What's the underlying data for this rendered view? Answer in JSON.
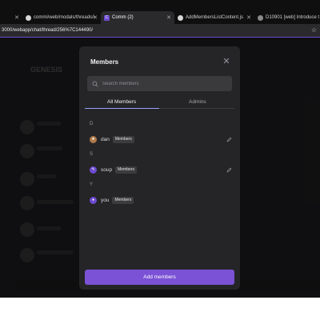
{
  "browser": {
    "tabs": [
      {
        "label": "commi/web/modals/threads/i",
        "icon": "github-icon"
      },
      {
        "label": "Comm (2)",
        "icon": "comm-icon",
        "active": true
      },
      {
        "label": "AddMembersListContent.js",
        "icon": "github-icon"
      },
      {
        "label": "D10901 [web] Introduce t",
        "icon": "phabricator-icon"
      }
    ],
    "url": "3000/webapp/chat/thread/256%7C144490/"
  },
  "background": {
    "community_name": "GENESIS"
  },
  "modal": {
    "title": "Members",
    "search_placeholder": "Search members",
    "tabs": [
      "All Members",
      "Admins"
    ],
    "groups": [
      {
        "letter": "D",
        "members": [
          {
            "name": "dan",
            "badge": "Members",
            "avatar_color": "#b07a4a",
            "avatar_glyph": "★",
            "editable": true
          }
        ]
      },
      {
        "letter": "S",
        "members": [
          {
            "name": "soup",
            "badge": "Members",
            "avatar_color": "#6d4bd0",
            "avatar_glyph": "✎",
            "editable": true
          }
        ]
      },
      {
        "letter": "Y",
        "members": [
          {
            "name": "you",
            "badge": "Members",
            "avatar_color": "#6d4bd0",
            "avatar_glyph": "●",
            "editable": false
          }
        ]
      }
    ],
    "add_button_label": "Add members"
  },
  "colors": {
    "accent": "#7b52d6",
    "modal_bg": "#252527"
  }
}
